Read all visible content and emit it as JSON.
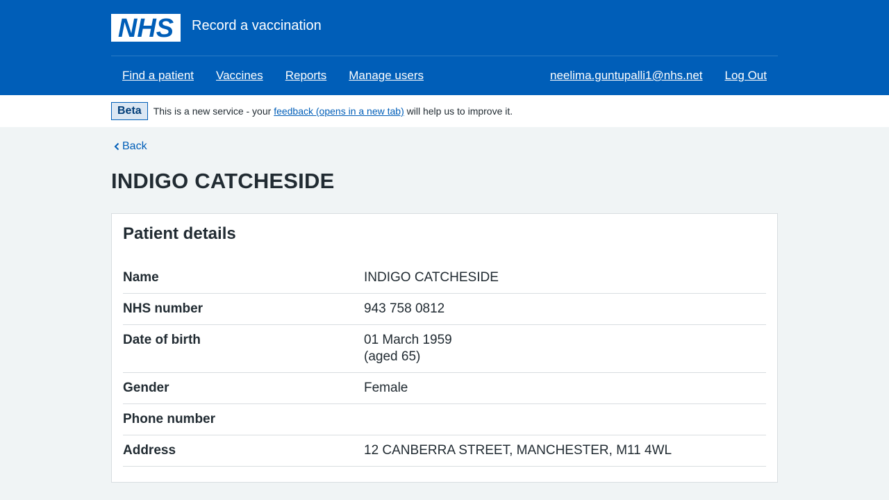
{
  "header": {
    "logo_text": "NHS",
    "service_name": "Record a vaccination",
    "nav": {
      "find_patient": "Find a patient",
      "vaccines": "Vaccines",
      "reports": "Reports",
      "manage_users": "Manage users",
      "user_email": "neelima.guntupalli1@nhs.net",
      "log_out": "Log Out"
    }
  },
  "phase_banner": {
    "tag": "Beta",
    "text_before": "This is a new service - your ",
    "link": "feedback (opens in a new tab)",
    "text_after": " will help us to improve it."
  },
  "back_link": "Back",
  "page_title": "INDIGO CATCHESIDE",
  "patient_card": {
    "heading": "Patient details",
    "rows": {
      "name": {
        "key": "Name",
        "value": "INDIGO CATCHESIDE"
      },
      "nhs_number": {
        "key": "NHS number",
        "value": "943 758 0812"
      },
      "dob": {
        "key": "Date of birth",
        "value": "01 March 1959",
        "age": "(aged 65)"
      },
      "gender": {
        "key": "Gender",
        "value": "Female"
      },
      "phone": {
        "key": "Phone number",
        "value": ""
      },
      "address": {
        "key": "Address",
        "value": "12 CANBERRA STREET, MANCHESTER, M11 4WL"
      }
    }
  },
  "colors": {
    "nhs_blue": "#005eb8",
    "background": "#f0f4f5",
    "text": "#212b32",
    "border": "#d8dde0"
  }
}
